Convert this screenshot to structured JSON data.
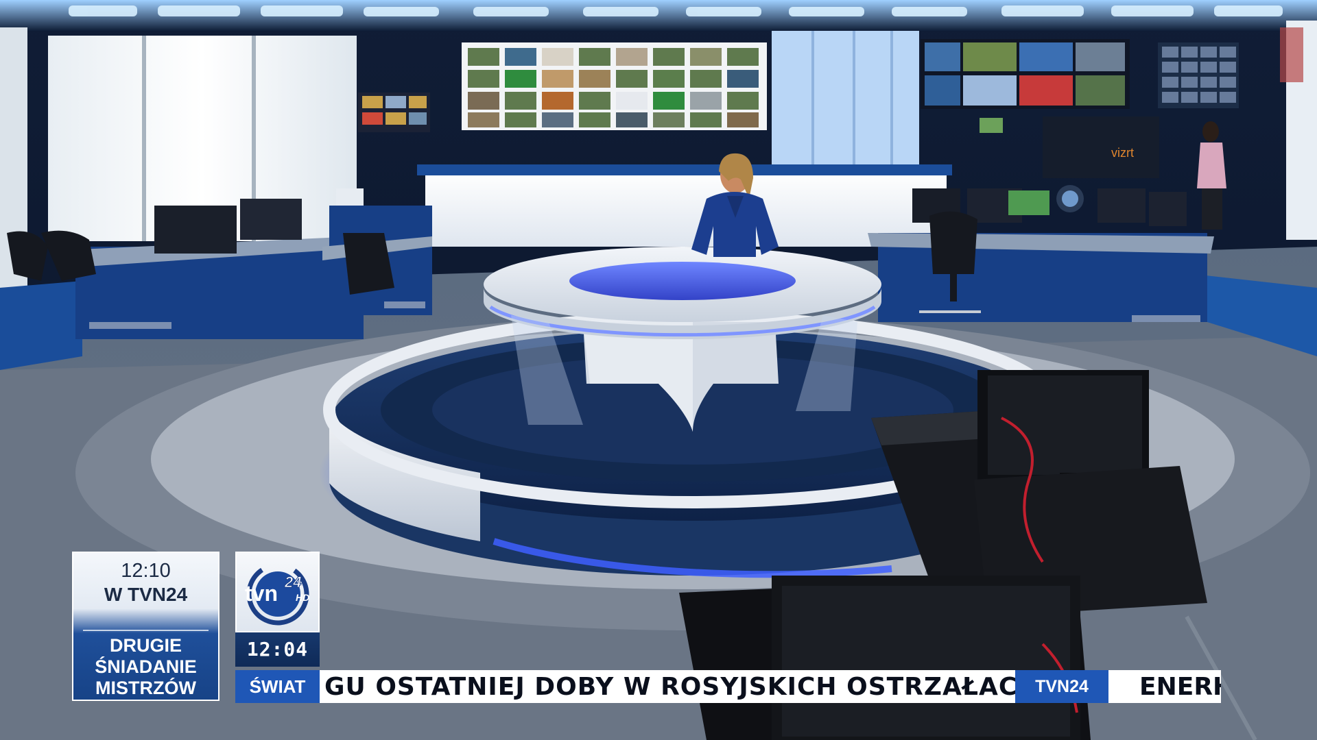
{
  "broadcast": {
    "next_program": {
      "time": "12:10",
      "channel": "W TVN24",
      "title_lines": [
        "DRUGIE",
        "ŚNIADANIE",
        "MISTRZÓW"
      ]
    },
    "logo": {
      "main": "tvn",
      "number": "24",
      "badge": "HD"
    },
    "clock": "12:04",
    "ticker": {
      "category": "ŚWIAT",
      "headline": "GU OSTATNIEJ DOBY W ROSYJSKICH OSTRZAŁACH",
      "brand": "TVN24",
      "next_headline": "ENERH"
    },
    "screen_brand": "vizrt"
  },
  "colors": {
    "accent_blue": "#1f57b6",
    "studio_navy": "#123a78",
    "led_blue": "#4a6dff"
  }
}
